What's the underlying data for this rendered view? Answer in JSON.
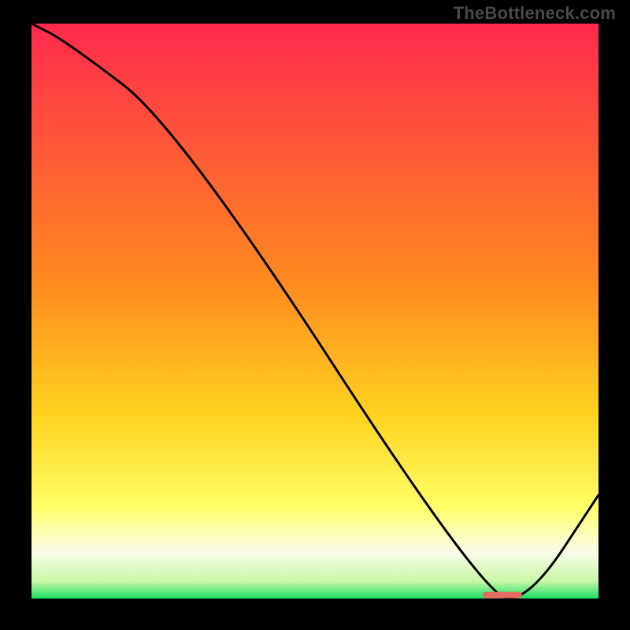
{
  "watermark": "TheBottleneck.com",
  "colors": {
    "bg": "#000000",
    "curve": "#000000",
    "grad_top": "#ff2a4d",
    "grad_mid1": "#ff8a1f",
    "grad_mid2": "#ffd21f",
    "grad_mid3": "#ffff66",
    "grad_low": "#fafceb",
    "grad_base": "#19e066",
    "marker": "#e86a62"
  },
  "chart_data": {
    "type": "line",
    "title": "",
    "xlabel": "",
    "ylabel": "",
    "xlim": [
      0,
      100
    ],
    "ylim": [
      0,
      100
    ],
    "x": [
      0,
      6,
      26,
      80,
      88,
      100
    ],
    "values": [
      100,
      97,
      82,
      0,
      0,
      18
    ],
    "marker": {
      "x_center": 83,
      "y": 0,
      "width_pct": 7,
      "height_pct": 1.2
    },
    "gradient_stops": [
      {
        "offset": 0,
        "color": "#ff2a4d"
      },
      {
        "offset": 45,
        "color": "#ff8a1f"
      },
      {
        "offset": 68,
        "color": "#ffd21f"
      },
      {
        "offset": 84,
        "color": "#ffff66"
      },
      {
        "offset": 92,
        "color": "#fafceb"
      },
      {
        "offset": 97,
        "color": "#c9f7a6"
      },
      {
        "offset": 100,
        "color": "#19e066"
      }
    ]
  }
}
